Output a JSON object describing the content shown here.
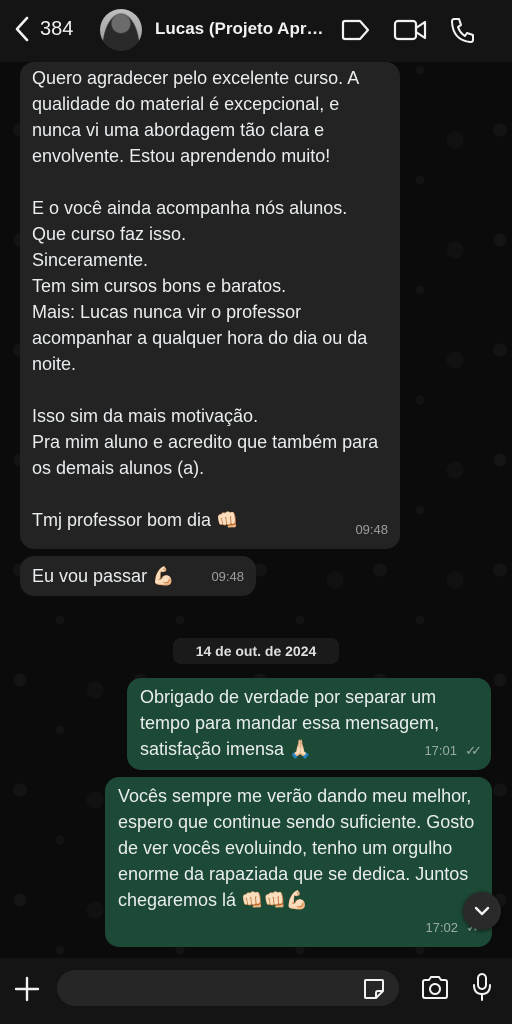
{
  "header": {
    "back_count": "384",
    "contact_name": "Lucas (Projeto Aprovação)"
  },
  "messages": [
    {
      "direction": "incoming",
      "text": "Quero agradecer pelo excelente curso. A qualidade do material é excepcional, e nunca vi uma abordagem tão clara e envolvente. Estou aprendendo muito!\n\nE o você ainda acompanha nós alunos.\nQue curso faz isso.\nSinceramente.\nTem sim cursos bons e baratos.\nMais: Lucas nunca vir o professor acompanhar a qualquer hora do dia ou da noite.\n\nIsso sim da mais motivação.\nPra mim aluno e acredito que também para os demais alunos (a).\n\nTmj professor bom dia 👊🏻",
      "time": "09:48"
    },
    {
      "direction": "incoming",
      "text": "Eu vou passar 💪🏻",
      "time": "09:48"
    },
    {
      "direction": "outgoing",
      "text": "Obrigado de verdade por separar um tempo para mandar essa mensagem, satisfação imensa 🙏🏻",
      "time": "17:01",
      "status": "read"
    },
    {
      "direction": "outgoing",
      "text": "Vocês sempre me verão dando meu melhor, espero que continue sendo suficiente. Gosto de ver vocês evoluindo, tenho um orgulho enorme da rapaziada que se dedica. Juntos chegaremos lá 👊🏻👊🏻💪🏻",
      "time": "17:02",
      "status": "read"
    }
  ],
  "date_separator": "14 de out. de 2024",
  "composer": {
    "placeholder": "",
    "icons": [
      "plus-icon",
      "sticker-icon",
      "camera-icon",
      "microphone-icon"
    ]
  },
  "colors": {
    "incoming_bubble": "#232323",
    "outgoing_bubble": "#1d4a36",
    "background": "#0b0b0b"
  }
}
